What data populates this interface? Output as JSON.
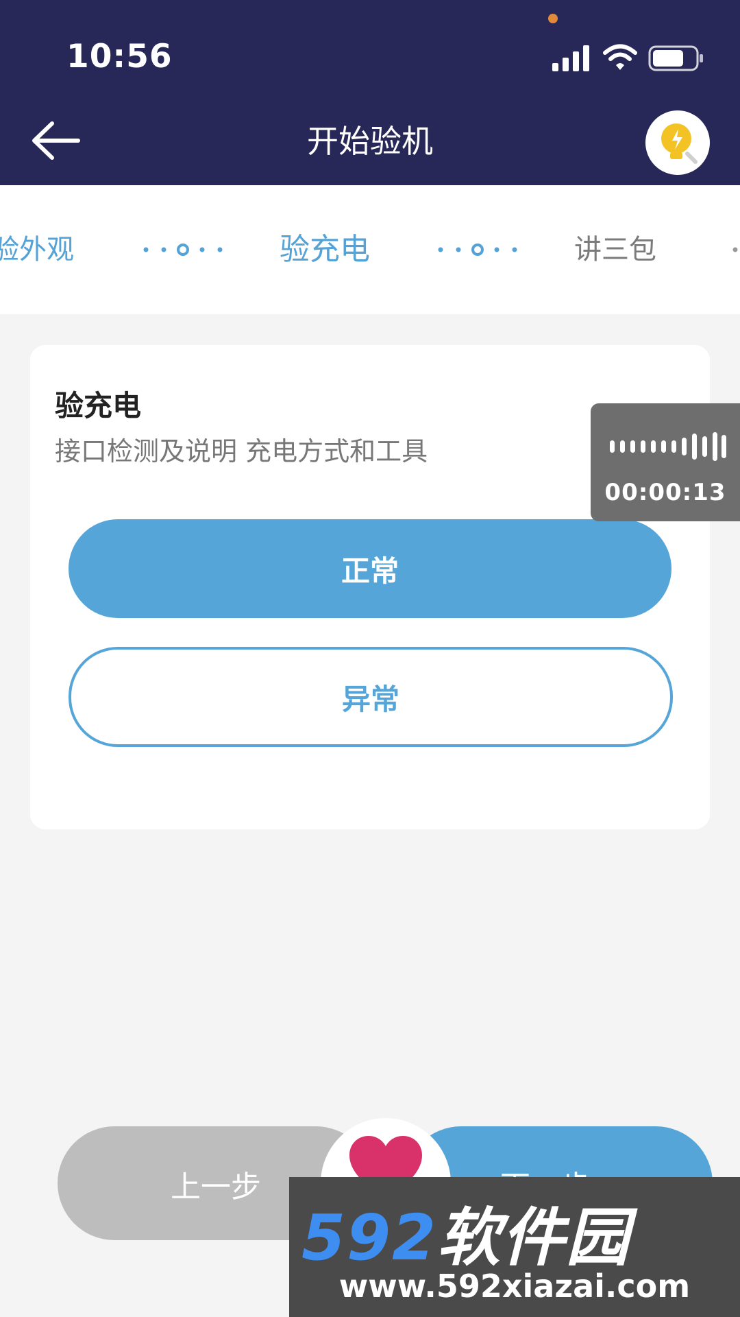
{
  "status_bar": {
    "time": "10:56"
  },
  "nav": {
    "title": "开始验机",
    "back_icon": "arrow-left-icon",
    "tip_icon": "lightbulb-icon"
  },
  "steps": [
    {
      "label": "验外观",
      "state": "done"
    },
    {
      "label": "验充电",
      "state": "current"
    },
    {
      "label": "讲三包",
      "state": "todo"
    }
  ],
  "card": {
    "title": "验充电",
    "description": "接口检测及说明 充电方式和工具",
    "normal_label": "正常",
    "abnormal_label": "异常"
  },
  "recorder": {
    "time": "00:00:13"
  },
  "footer": {
    "prev_label": "上一步",
    "next_label": "下一步"
  },
  "watermark": {
    "logo_number": "592",
    "logo_text": "软件园",
    "url": "www.592xiazai.com"
  },
  "colors": {
    "header": "#282858",
    "accent": "#55a5d8",
    "muted": "#bdbdbd"
  }
}
